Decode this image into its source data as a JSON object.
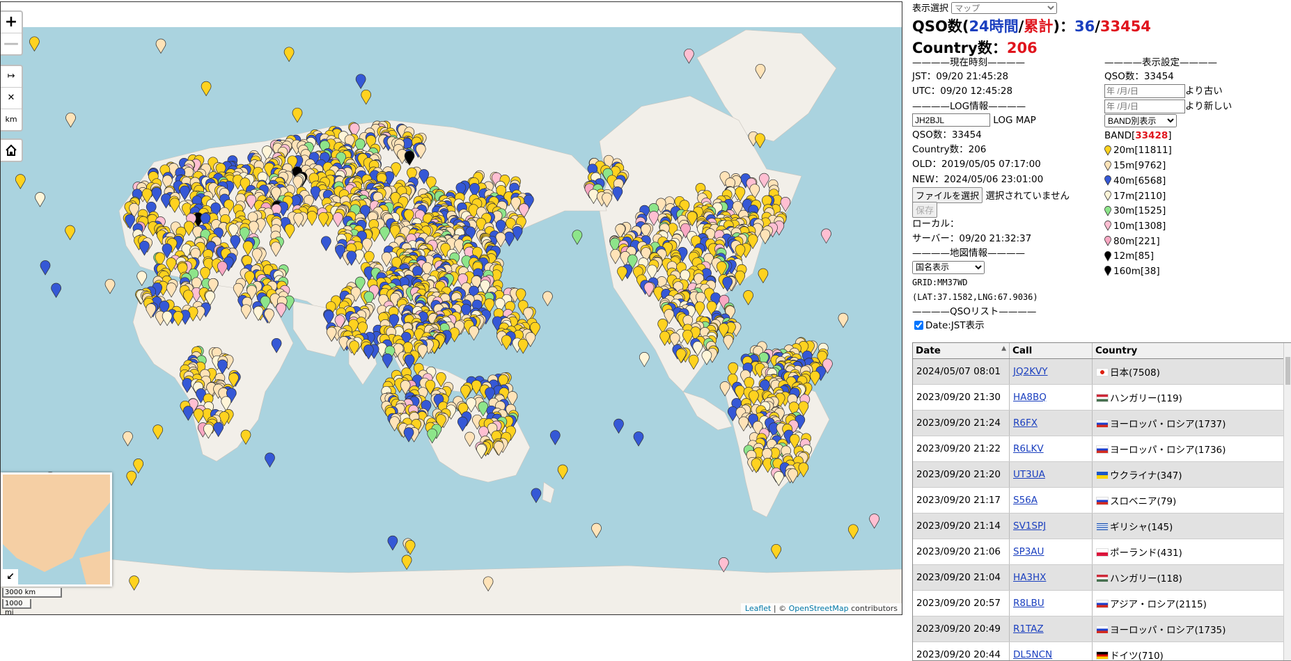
{
  "map": {
    "zoom_in": "+",
    "zoom_out": "—",
    "measure_icons": [
      "↦",
      "✕",
      "km"
    ],
    "scale_km": "3000 km",
    "scale_mi": "1000 mi",
    "attribution_leaflet": "Leaflet",
    "attribution_sep": " | © ",
    "attribution_osm": "OpenStreetMap",
    "attribution_tail": " contributors",
    "land_color": "#f2efe9",
    "water_color": "#aad3df"
  },
  "panel": {
    "display_select_label": "表示選択",
    "display_select_value": "マップ",
    "qso_label_pre": "QSO数(",
    "qso_24h_label": "24時間",
    "qso_slash": "/",
    "qso_total_label": "累計",
    "qso_label_post": ")：",
    "qso_24h": "36",
    "qso_total": "33454",
    "country_label": "Country数：",
    "country_count": "206",
    "time_section": "————現在時刻————",
    "jst": "JST：09/20 21:45:28",
    "utc": "UTC：09/20 12:45:28",
    "log_section": "————LOG情報————",
    "callsign": "JH2BJL",
    "log_map_label": "LOG MAP",
    "log_qso": "QSO数：33454",
    "log_country": "Country数：206",
    "old": "OLD：2019/05/05 07:17:00",
    "new": "NEW：2024/05/06 23:01:00",
    "file_button": "ファイルを選択",
    "file_status": "選択されていません",
    "save_button": "保存",
    "local": "ローカル：",
    "server": "サーバー：09/20 21:32:37",
    "mapinfo_section": "————地図情報————",
    "map_select_value": "国名表示",
    "grid": "GRID:MM37WD",
    "latlng": "(LAT:37.1582,LNG:67.9036)",
    "qsolist_section": "————QSOリスト————",
    "date_jst_label": "Date:JST表示",
    "settings_section": "————表示設定————",
    "settings_qso": "QSO数：33454",
    "date_placeholder": "年 /月/日",
    "older_label": "より古い",
    "newer_label": "より新しい",
    "band_select_value": "BAND別表示",
    "band_total_label": "BAND[",
    "band_total": "33428",
    "band_total_close": "]",
    "bands": [
      {
        "label": "20m[11811]",
        "color": "#ffd21f"
      },
      {
        "label": "15m[9762]",
        "color": "#ffe3b8"
      },
      {
        "label": "40m[6568]",
        "color": "#3558d6"
      },
      {
        "label": "17m[2110]",
        "color": "#fff5d8"
      },
      {
        "label": "30m[1525]",
        "color": "#8de58a"
      },
      {
        "label": "10m[1308]",
        "color": "#ffbfd2"
      },
      {
        "label": "80m[221]",
        "color": "#f9a8c3"
      },
      {
        "label": "12m[85]",
        "color": "#000000"
      },
      {
        "label": "160m[38]",
        "color": "#000000"
      }
    ]
  },
  "table": {
    "headers": [
      "Date",
      "Call",
      "Country"
    ],
    "rows": [
      {
        "date": "2024/05/07 08:01",
        "call": "JQ2KVY",
        "country": "日本(7508)",
        "flag": "jp"
      },
      {
        "date": "2023/09/20 21:30",
        "call": "HA8BQ",
        "country": "ハンガリー(119)",
        "flag": "hu"
      },
      {
        "date": "2023/09/20 21:24",
        "call": "R6FX",
        "country": "ヨーロッパ・ロシア(1737)",
        "flag": "ru"
      },
      {
        "date": "2023/09/20 21:22",
        "call": "R6LKV",
        "country": "ヨーロッパ・ロシア(1736)",
        "flag": "ru"
      },
      {
        "date": "2023/09/20 21:20",
        "call": "UT3UA",
        "country": "ウクライナ(347)",
        "flag": "ua"
      },
      {
        "date": "2023/09/20 21:17",
        "call": "S56A",
        "country": "スロベニア(79)",
        "flag": "si"
      },
      {
        "date": "2023/09/20 21:14",
        "call": "SV1SPJ",
        "country": "ギリシャ(145)",
        "flag": "gr"
      },
      {
        "date": "2023/09/20 21:06",
        "call": "SP3AU",
        "country": "ポーランド(431)",
        "flag": "pl"
      },
      {
        "date": "2023/09/20 21:04",
        "call": "HA3HX",
        "country": "ハンガリー(118)",
        "flag": "hu"
      },
      {
        "date": "2023/09/20 20:57",
        "call": "R8LBU",
        "country": "アジア・ロシア(2115)",
        "flag": "ru"
      },
      {
        "date": "2023/09/20 20:49",
        "call": "R1TAZ",
        "country": "ヨーロッパ・ロシア(1735)",
        "flag": "ru"
      },
      {
        "date": "2023/09/20 20:44",
        "call": "DL5NCN",
        "country": "ドイツ(710)",
        "flag": "de"
      }
    ]
  }
}
